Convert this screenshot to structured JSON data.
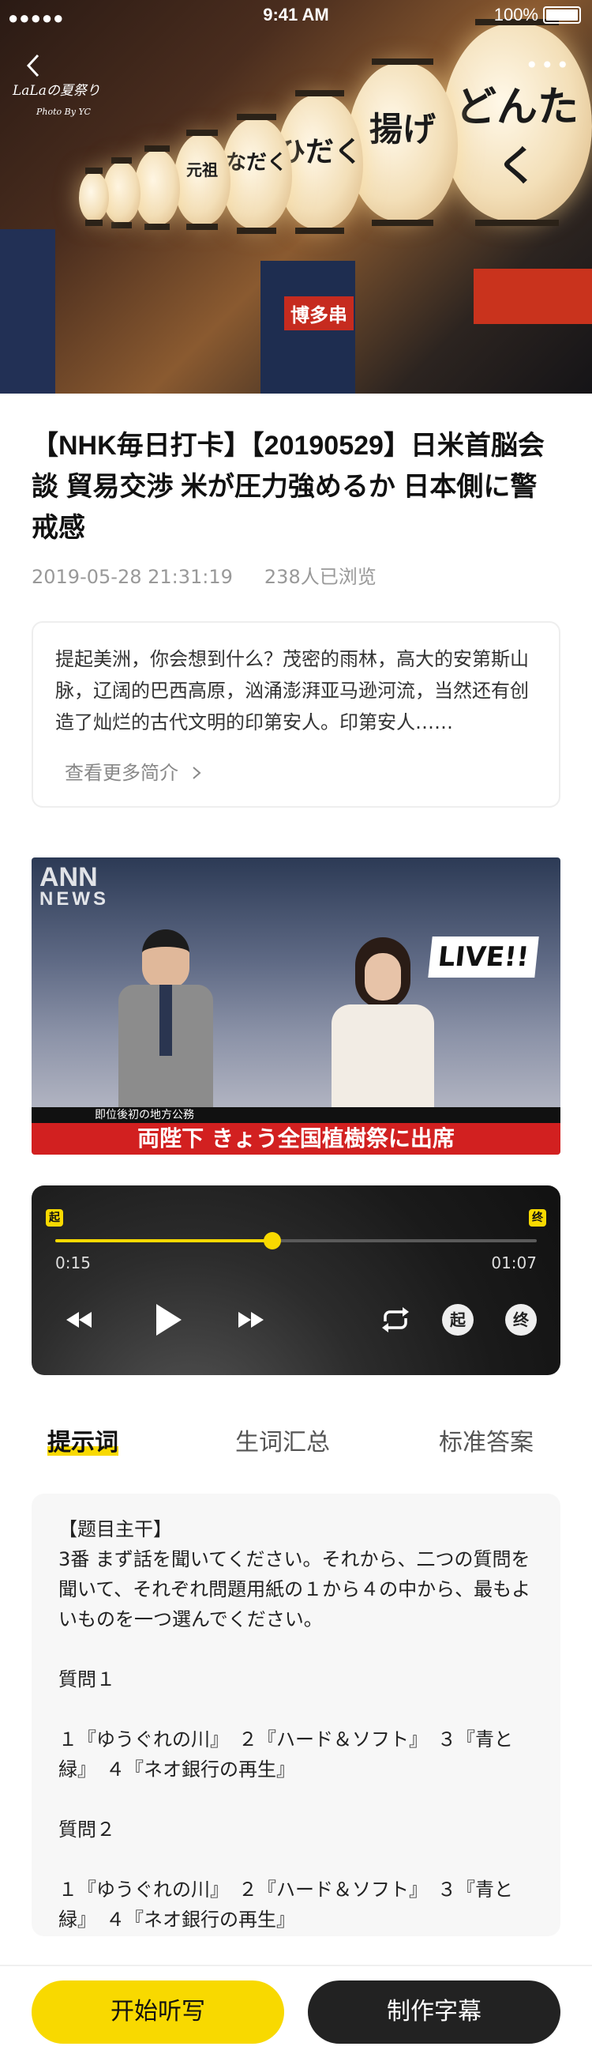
{
  "status_bar": {
    "signal": "●●●●●",
    "time": "9:41 AM",
    "battery": "100%"
  },
  "hero": {
    "watermark_title": "LaLaの夏祭り",
    "watermark_credit": "Photo By YC",
    "lanterns": [
      "どんたく",
      "揚げ",
      "ひだく",
      "なだく",
      "元祖"
    ],
    "sign_text": "博多串"
  },
  "article": {
    "title": "【NHK毎日打卡】【20190529】日米首脳会談 貿易交渉 米が圧力強めるか 日本側に警戒感",
    "datetime": "2019-05-28 21:31:19",
    "views": "238人已浏览",
    "intro": "提起美洲，你会想到什么？茂密的雨林，高大的安第斯山脉，辽阔的巴西高原，汹涌澎湃亚马逊河流，当然还有创造了灿烂的古代文明的印第安人。印第安人……",
    "more_intro": "查看更多简介"
  },
  "video": {
    "logo": "ANN",
    "logo_sub": "NEWS",
    "live_badge": "LIVE!!",
    "lower_caption": "即位後初の地方公務",
    "headline": "両陛下 きょう全国植樹祭に出席"
  },
  "player": {
    "start_mark": "起",
    "end_mark": "终",
    "current_time": "0:15",
    "total_time": "01:07",
    "progress": 0.45,
    "loop_start_label": "起",
    "loop_end_label": "终"
  },
  "tabs": [
    "提示词",
    "生词汇总",
    "标准答案"
  ],
  "prompt": {
    "heading": "【题目主干】",
    "body": "3番 まず話を聞いてください。それから、二つの質問を聞いて、それぞれ問題用紙の１から４の中から、最もよいものを一つ選んでください。",
    "q1_label": "質問１",
    "q1_options": "１『ゆうぐれの川』　２『ハード＆ソフト』　３『青と緑』　４『ネオ銀行の再生』",
    "q2_label": "質問２",
    "q2_options": "１『ゆうぐれの川』　２『ハード＆ソフト』　３『青と緑』　４『ネオ銀行の再生』"
  },
  "actions": {
    "start": "开始听写",
    "subtitle": "制作字幕"
  }
}
